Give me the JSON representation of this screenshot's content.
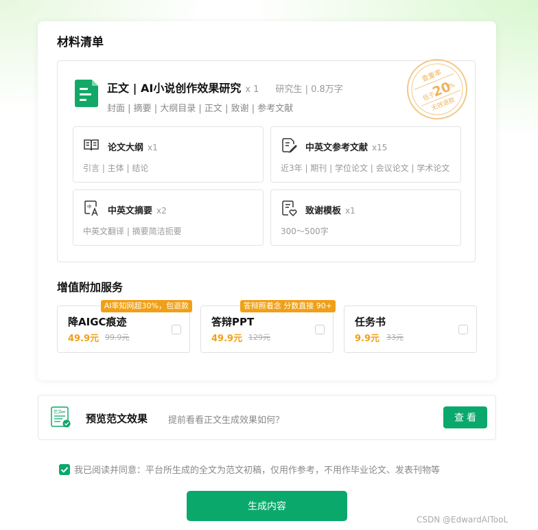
{
  "materials": {
    "title": "材料清单",
    "main": {
      "title": "正文 | AI小说创作效果研究",
      "count": "x 1",
      "meta": "研究生 | 0.8万字",
      "sub": "封面 | 摘要 | 大纲目录 | 正文 | 致谢 | 参考文献"
    },
    "stamp": {
      "top": "查重率",
      "pre": "低于",
      "num": "20",
      "pct": "%",
      "bottom": "无效退款"
    },
    "items": [
      {
        "name": "论文大纲",
        "count": "x1",
        "desc": "引言 | 主体 | 结论",
        "icon": "book-open-icon"
      },
      {
        "name": "中英文参考文献",
        "count": "x15",
        "desc": "近3年 | 期刊 | 学位论文 | 会议论文 | 学术论文",
        "icon": "document-edit-icon"
      },
      {
        "name": "中英文摘要",
        "count": "x2",
        "desc": "中英文翻译 | 摘要简洁扼要",
        "icon": "translate-icon"
      },
      {
        "name": "致谢模板",
        "count": "x1",
        "desc": "300～500字",
        "icon": "document-heart-icon"
      }
    ]
  },
  "addons": {
    "title": "增值附加服务",
    "items": [
      {
        "badge": "AI率知网超30%，包退款",
        "name": "降AIGC痕迹",
        "price": "49.9元",
        "old": "99.9元"
      },
      {
        "badge": "答辩照着念 分数直接 90+",
        "name": "答辩PPT",
        "price": "49.9元",
        "old": "129元"
      },
      {
        "badge": "",
        "name": "任务书",
        "price": "9.9元",
        "old": "33元"
      }
    ]
  },
  "preview": {
    "icon_text": "范文",
    "title": "预览范文效果",
    "desc": "提前看看正文生成效果如何？",
    "button": "查看"
  },
  "agreement": "我已阅读并同意：平台所生成的全文为范文初稿，仅用作参考，不用作毕业论文、发表刊物等",
  "generate_button": "生成内容",
  "watermark": "CSDN @EdwardAITooL",
  "colors": {
    "accent": "#0ba86c",
    "price": "#f0a017",
    "stamp": "#f3c788"
  }
}
